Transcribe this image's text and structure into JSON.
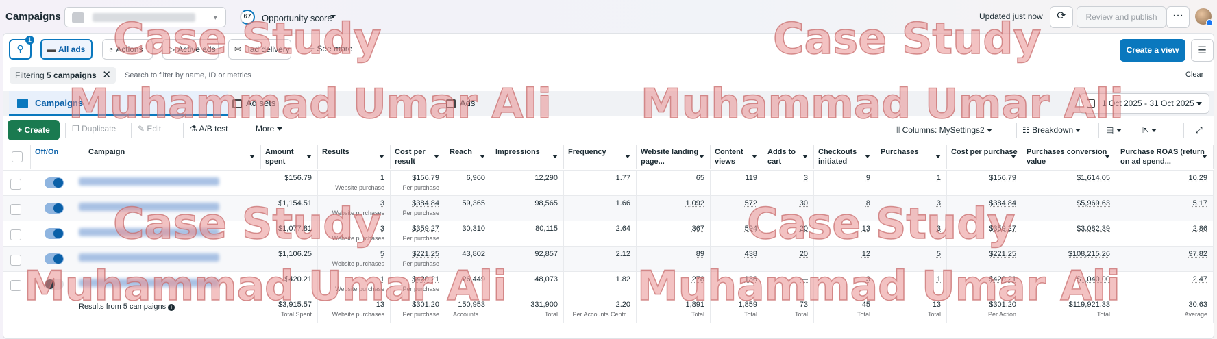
{
  "header": {
    "title": "Campaigns",
    "opportunity_score_value": "67",
    "opportunity_score_label": "Opportunity score",
    "updated_label": "Updated just now",
    "review_label": "Review and publish",
    "more_icon": "ellipsis-icon"
  },
  "filters": {
    "search_badge": "1",
    "quick": [
      "All ads",
      "Actions",
      "Active ads",
      "Had delivery",
      "See more"
    ],
    "create_view": "Create a view",
    "filtering_prefix": "Filtering",
    "filtering_count": "5 campaigns",
    "search_placeholder": "Search to filter by name, ID or metrics",
    "clear": "Clear"
  },
  "levels": {
    "campaigns": "Campaigns",
    "ad_sets": "Ad sets",
    "ads": "Ads"
  },
  "date_range": "1 Oct 2025 - 31 Oct 2025",
  "toolbar": {
    "create": "Create",
    "duplicate": "Duplicate",
    "edit": "Edit",
    "ab_test": "A/B test",
    "more": "More",
    "columns": "Columns: MySettings2",
    "breakdown": "Breakdown"
  },
  "table": {
    "headers": [
      "Off/On",
      "Campaign",
      "Amount spent",
      "Results",
      "Cost per result",
      "Reach",
      "Impressions",
      "Frequency",
      "Website landing page...",
      "Content views",
      "Adds to cart",
      "Checkouts initiated",
      "Purchases",
      "Cost per purchase",
      "Purchases conversion value",
      "Purchase ROAS (return on ad spend..."
    ],
    "rows": [
      {
        "on": true,
        "spent": "$156.79",
        "results": "1",
        "results_sub": "Website purchase",
        "cpr": "$156.79",
        "cpr_sub": "Per purchase",
        "reach": "6,960",
        "impr": "12,290",
        "freq": "1.77",
        "wlp": "65",
        "cv": "119",
        "atc": "3",
        "ci": "9",
        "purch": "1",
        "cpp": "$156.79",
        "pcv": "$1,614.05",
        "roas": "10.29"
      },
      {
        "on": true,
        "spent": "$1,154.51",
        "results": "3",
        "results_sub": "Website purchases",
        "cpr": "$384.84",
        "cpr_sub": "Per purchase",
        "reach": "59,365",
        "impr": "98,565",
        "freq": "1.66",
        "wlp": "1,092",
        "cv": "572",
        "atc": "30",
        "ci": "8",
        "purch": "3",
        "cpp": "$384.84",
        "pcv": "$5,969.63",
        "roas": "5.17"
      },
      {
        "on": true,
        "spent": "$1,077.81",
        "results": "3",
        "results_sub": "Website purchases",
        "cpr": "$359.27",
        "cpr_sub": "Per purchase",
        "reach": "30,310",
        "impr": "80,115",
        "freq": "2.64",
        "wlp": "367",
        "cv": "594",
        "atc": "20",
        "ci": "13",
        "purch": "3",
        "cpp": "$359.27",
        "pcv": "$3,082.39",
        "roas": "2.86"
      },
      {
        "on": true,
        "spent": "$1,106.25",
        "results": "5",
        "results_sub": "Website purchases",
        "cpr": "$221.25",
        "cpr_sub": "Per purchase",
        "reach": "43,802",
        "impr": "92,857",
        "freq": "2.12",
        "wlp": "89",
        "cv": "438",
        "atc": "20",
        "ci": "12",
        "purch": "5",
        "cpp": "$221.25",
        "pcv": "$108,215.26",
        "roas": "97.82"
      },
      {
        "on": false,
        "spent": "$420.21",
        "results": "1",
        "results_sub": "Website purchase",
        "cpr": "$420.21",
        "cpr_sub": "Per purchase",
        "reach": "26,449",
        "impr": "48,073",
        "freq": "1.82",
        "wlp": "278",
        "cv": "136",
        "atc": "—",
        "ci": "3",
        "purch": "1",
        "cpp": "$420.21",
        "pcv": "$1,040.00",
        "roas": "2.47"
      }
    ],
    "totals": {
      "label": "Results from 5 campaigns",
      "spent": "$3,915.57",
      "spent_sub": "Total Spent",
      "results": "13",
      "results_sub": "Website purchases",
      "cpr": "$301.20",
      "cpr_sub": "Per purchase",
      "reach": "150,953",
      "reach_sub": "Accounts ...",
      "impr": "331,900",
      "impr_sub": "Total",
      "freq": "2.20",
      "freq_sub": "Per Accounts Centr...",
      "wlp": "1,891",
      "wlp_sub": "Total",
      "cv": "1,859",
      "cv_sub": "Total",
      "atc": "73",
      "atc_sub": "Total",
      "ci": "45",
      "ci_sub": "Total",
      "purch": "13",
      "purch_sub": "Total",
      "cpp": "$301.20",
      "cpp_sub": "Per Action",
      "pcv": "$119,921.33",
      "pcv_sub": "Total",
      "roas": "30.63",
      "roas_sub": "Average"
    }
  },
  "watermark": {
    "line1": "Case Study",
    "line2": "Muhammad Umar Ali"
  }
}
